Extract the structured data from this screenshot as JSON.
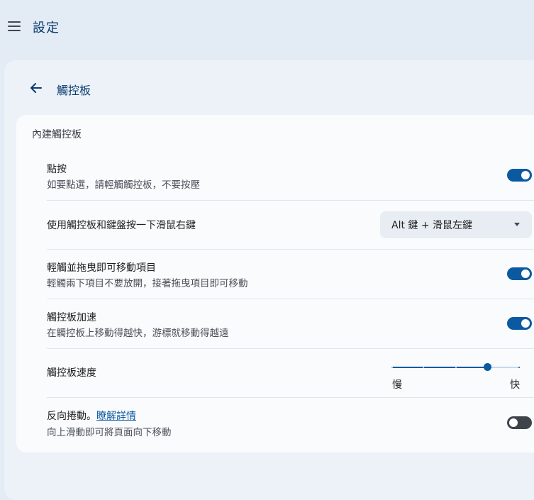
{
  "app_title": "設定",
  "page_title": "觸控板",
  "section_title": "內建觸控板",
  "rows": {
    "tap": {
      "label": "點按",
      "sub": "如要點選，請輕觸觸控板，不要按壓",
      "toggle_on": true
    },
    "secondary_click": {
      "label": "使用觸控板和鍵盤按一下滑鼠右鍵",
      "dropdown_value": "Alt 鍵 + 滑鼠左鍵"
    },
    "tap_drag": {
      "label": "輕觸並拖曳即可移動項目",
      "sub": "輕觸兩下項目不要放開，接著拖曳項目即可移動",
      "toggle_on": true
    },
    "acceleration": {
      "label": "觸控板加速",
      "sub": "在觸控板上移動得越快，游標就移動得越遠",
      "toggle_on": true
    },
    "speed": {
      "label": "觸控板速度",
      "min_label": "慢",
      "max_label": "快",
      "value": 4,
      "min": 1,
      "max": 5
    },
    "reverse_scroll": {
      "label": "反向捲動。",
      "link": "瞭解詳情",
      "sub": "向上滑動即可將頁面向下移動",
      "toggle_on": false
    }
  },
  "colors": {
    "accent": "#0b5aa1",
    "background": "#e3ebf5",
    "card": "#fafbfd",
    "title": "#0b3b6e"
  },
  "icons": {
    "menu": "hamburger-menu-icon",
    "back": "arrow-left-icon",
    "dropdown": "caret-down-icon"
  }
}
